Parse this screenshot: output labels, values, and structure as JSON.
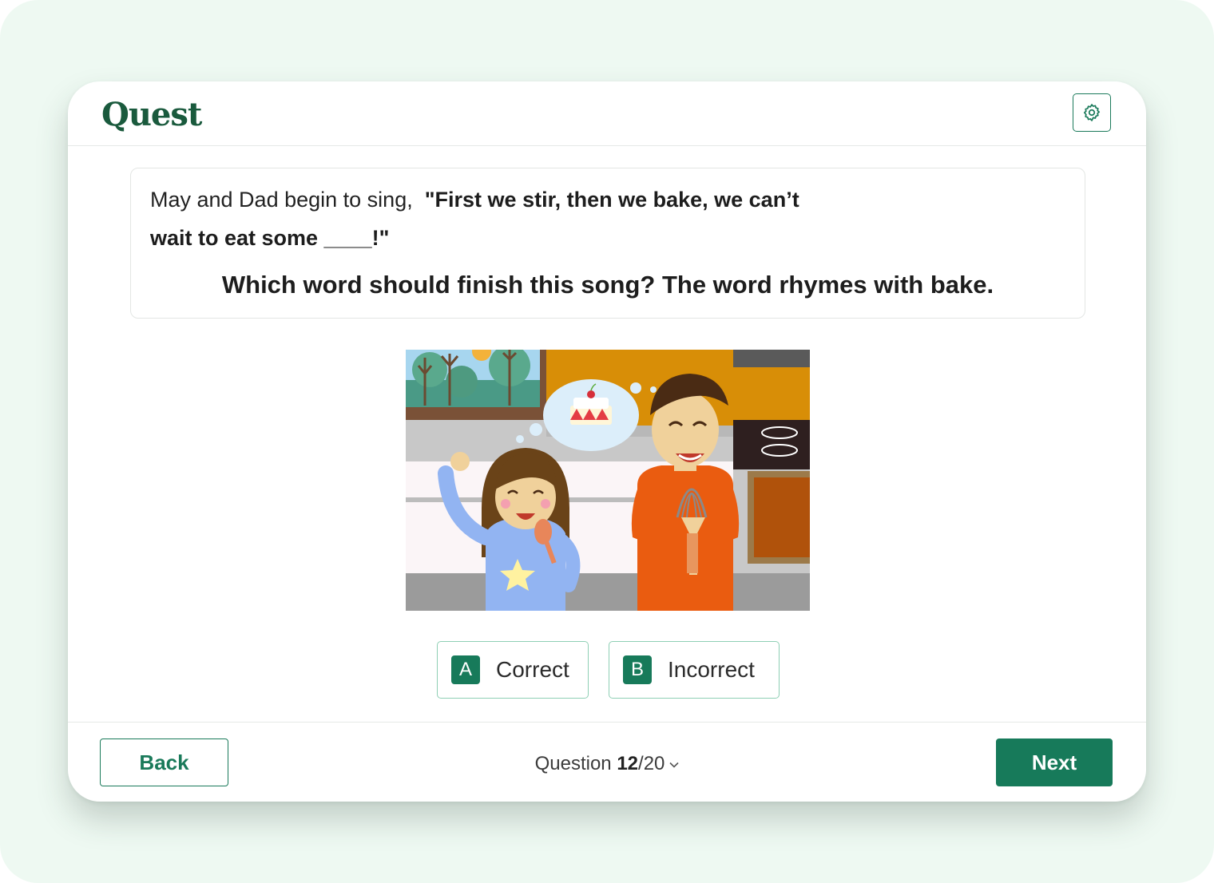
{
  "app": {
    "logo_text": "Quest"
  },
  "header": {
    "settings_icon": "gear-icon"
  },
  "prompt": {
    "intro": "May and Dad begin to sing,",
    "song_part1": "\"First we stir, then we bake, we can’t",
    "song_part2": "wait to eat some ____!\"",
    "question": "Which word should finish this song? The word rhymes with bake."
  },
  "illustration": {
    "description_icon": "kitchen-scene-illustration"
  },
  "options": [
    {
      "letter": "A",
      "label": "Correct"
    },
    {
      "letter": "B",
      "label": "Incorrect"
    }
  ],
  "footer": {
    "back_label": "Back",
    "next_label": "Next",
    "question_word": "Question",
    "current": "12",
    "total_suffix": "/20"
  },
  "colors": {
    "brand": "#1a5a3d",
    "accent": "#177a5a",
    "background": "#eef9f2"
  }
}
